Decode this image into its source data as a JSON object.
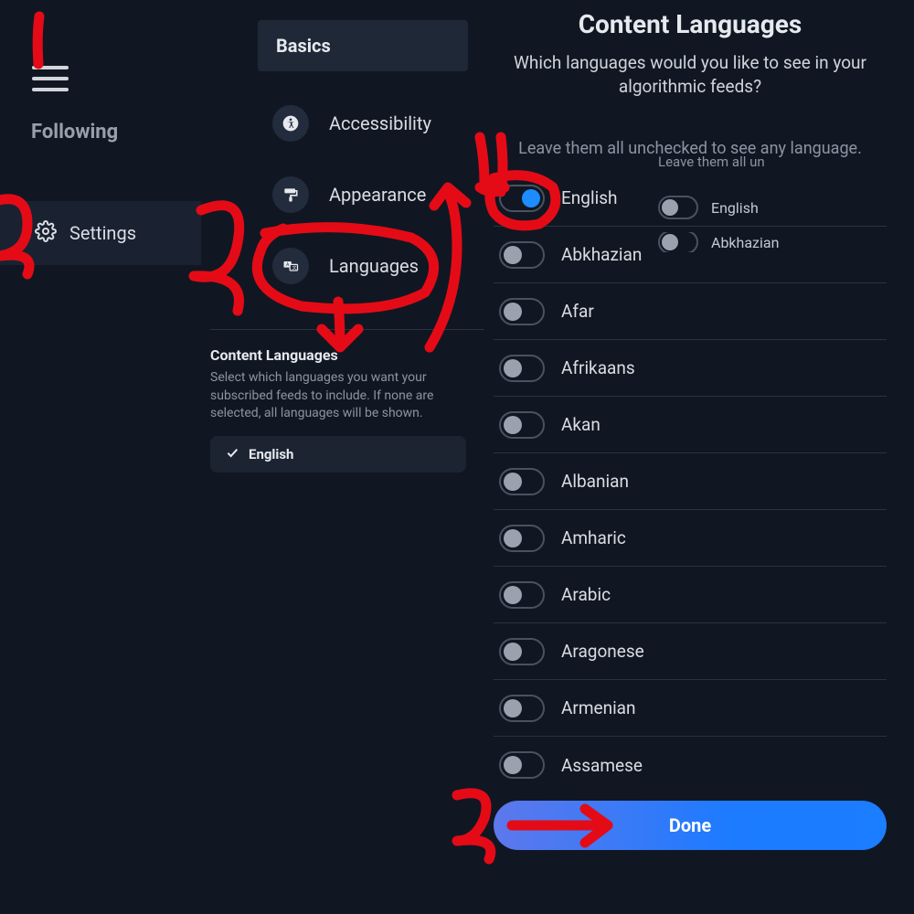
{
  "left": {
    "following_label": "Following",
    "settings_label": "Settings"
  },
  "basics": {
    "header": "Basics",
    "items": [
      {
        "label": "Accessibility",
        "icon": "accessibility"
      },
      {
        "label": "Appearance",
        "icon": "appearance"
      },
      {
        "label": "Languages",
        "icon": "languages"
      }
    ]
  },
  "content_languages": {
    "title": "Content Languages",
    "subtitle": "Select which languages you want your subscribed feeds to include. If none are selected, all languages will be shown.",
    "selected_chip": "English"
  },
  "right_panel": {
    "title": "Content Languages",
    "subtitle": "Which languages would you like to see in your algorithmic feeds?",
    "hint": "Leave them all unchecked to see any language.",
    "ghost_hint": "Leave them all un",
    "done_label": "Done",
    "languages": [
      {
        "label": "English",
        "on": true
      },
      {
        "label": "Abkhazian",
        "on": false
      },
      {
        "label": "Afar",
        "on": false
      },
      {
        "label": "Afrikaans",
        "on": false
      },
      {
        "label": "Akan",
        "on": false
      },
      {
        "label": "Albanian",
        "on": false
      },
      {
        "label": "Amharic",
        "on": false
      },
      {
        "label": "Arabic",
        "on": false
      },
      {
        "label": "Aragonese",
        "on": false
      },
      {
        "label": "Armenian",
        "on": false
      },
      {
        "label": "Assamese",
        "on": false
      }
    ],
    "ghost_languages": [
      {
        "label": "English",
        "on": false
      },
      {
        "label": "Abkhazian",
        "on": false
      }
    ]
  },
  "annotations": {
    "1": "1",
    "2": "2",
    "3": "3",
    "4": "4",
    "5": "5"
  },
  "colors": {
    "accent": "#1d8cff",
    "bg": "#111722",
    "panel": "#1f2836",
    "red": "#e40b17"
  }
}
